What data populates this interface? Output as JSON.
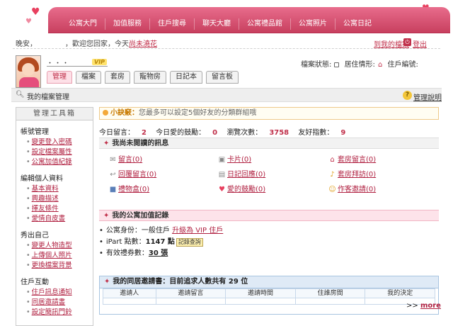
{
  "header": {
    "nav_tabs": [
      "公寓大門",
      "加值服務",
      "住戶搜尋",
      "聊天大廳",
      "公寓禮品館",
      "公寓照片",
      "公寓日記"
    ],
    "greeting_prefix": "晚安，",
    "greeting_mid": "，歡迎您回家，今天",
    "greeting_link": "尚未澆花",
    "return_link": "到我的檔案",
    "logout": "登出",
    "accent_color": "#c8405f"
  },
  "profile": {
    "nickname": "・・・",
    "vip": "VIP",
    "status_label": "檔案狀態:",
    "residence_label": "居住情形:",
    "household_id_label": "住戶編號:",
    "tabs": [
      "管理",
      "檔案",
      "套房",
      "寵物房",
      "日記本",
      "留言板"
    ],
    "active_tab": "管理"
  },
  "titlebar": {
    "title": "我的檔案管理",
    "help": "管理說明"
  },
  "sidebar": {
    "title": "管理工具箱",
    "sections": [
      {
        "title": "帳號管理",
        "items": [
          "變更登入密碼",
          "設定檔案屬性",
          "公寓加值紀錄"
        ]
      },
      {
        "title": "編輯個人資料",
        "items": [
          "基本資料",
          "興趣描述",
          "擇友條件",
          "愛情自皮書"
        ]
      },
      {
        "title": "秀出自己",
        "items": [
          "變更人物造型",
          "上傳個人照片",
          "更換檔案背景"
        ]
      },
      {
        "title": "住戶互動",
        "items": [
          "住戶訊息通知",
          "同居邀請書",
          "設定簡訊門鈴"
        ]
      }
    ]
  },
  "tip": {
    "label": "小訣竅：",
    "text": "您最多可以設定5個好友的分類群組哦"
  },
  "stats": {
    "today_msg_label": "今日留言：",
    "today_msg": "2",
    "today_love_label": "今日愛的鼓勵：",
    "today_love": "0",
    "views_label": "瀏覽次數：",
    "views": "3758",
    "friend_label": "友好指數：",
    "friend": "9"
  },
  "unread": {
    "title": "我尚未閱讀的訊息",
    "items": [
      {
        "label": "留言(0)",
        "icon": "message-icon"
      },
      {
        "label": "卡片(0)",
        "icon": "card-icon"
      },
      {
        "label": "套房留言(0)",
        "icon": "suite-message-icon"
      },
      {
        "label": "回覆留言(0)",
        "icon": "reply-icon"
      },
      {
        "label": "日記回應(0)",
        "icon": "diary-icon"
      },
      {
        "label": "套房拜訪(0)",
        "icon": "bell-icon"
      },
      {
        "label": "禮物盒(0)",
        "icon": "gift-icon"
      },
      {
        "label": "愛的鼓勵(0)",
        "icon": "heart-icon"
      },
      {
        "label": "作客邀請(0)",
        "icon": "invite-icon"
      }
    ]
  },
  "value_record": {
    "title": "我的公寓加值記錄",
    "identity_label": "公寓身份：一般住戶",
    "upgrade_link": "升級為 VIP 住戶",
    "ipart_label": "iPart 點數：",
    "ipart_value": "1147 點",
    "record_btn": "記錄查詢",
    "vouchers_label": "有效禮券數：",
    "vouchers_value": "30 張"
  },
  "invites": {
    "title": "我的同居邀請書：目前追求人數共有 29 位",
    "columns": [
      "邀請人",
      "邀請留言",
      "邀請時間",
      "住誰房間",
      "我的決定"
    ],
    "more_prefix": ">>",
    "more": "more"
  }
}
